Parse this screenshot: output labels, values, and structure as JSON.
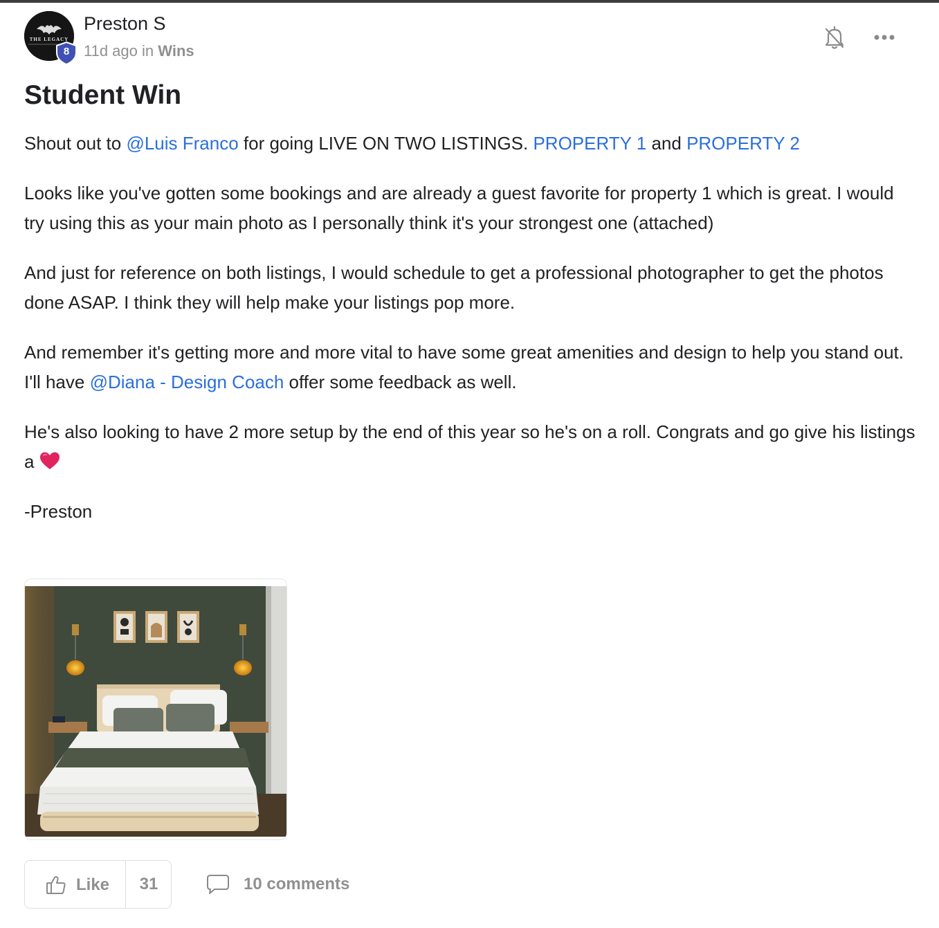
{
  "post": {
    "author": {
      "name": "Preston S",
      "level": "8",
      "avatar_icon": "bat-logo-avatar",
      "avatar_text": "THE LEGACY"
    },
    "meta": {
      "time": "11d ago",
      "in_word": "in",
      "category": "Wins"
    },
    "actions": {
      "notification_icon": "bell-off-icon",
      "more_icon": "more-horizontal-icon"
    },
    "title": "Student Win",
    "body": {
      "p1": {
        "t1": "Shout out to ",
        "mention": "@Luis Franco",
        "t2": " for going LIVE ON TWO LISTINGS. ",
        "link1": "PROPERTY 1",
        "t3": " and ",
        "link2": "PROPERTY 2"
      },
      "p2": "Looks like you've gotten some bookings and are already a guest favorite for property 1 which is great. I would try using this as your main photo as I personally think it's your strongest one (attached)",
      "p3": "And just for reference on both listings, I would schedule to get a professional photographer to get the photos done ASAP. I think they will help make your listings pop more.",
      "p4": {
        "t1": "And remember it's getting more and more vital to have some great amenities and design to help you stand out. I'll have ",
        "mention": "@Diana - Design Coach",
        "t2": " offer some feedback as well."
      },
      "p5": {
        "t1": "He's also looking to have 2 more setup by the end of this year so he's on a roll. Congrats and go give his listings a ",
        "emoji": "red-heart"
      },
      "signature": "-Preston"
    },
    "attachment": {
      "type": "image",
      "description_icon": "bedroom-photo"
    },
    "footer": {
      "like_label": "Like",
      "like_count": "31",
      "comments_label": "10 comments"
    }
  },
  "colors": {
    "link": "#2a6fdb",
    "text": "#202124",
    "muted": "#909090",
    "badge": "#3f51b5",
    "heart": "#e0245e"
  }
}
